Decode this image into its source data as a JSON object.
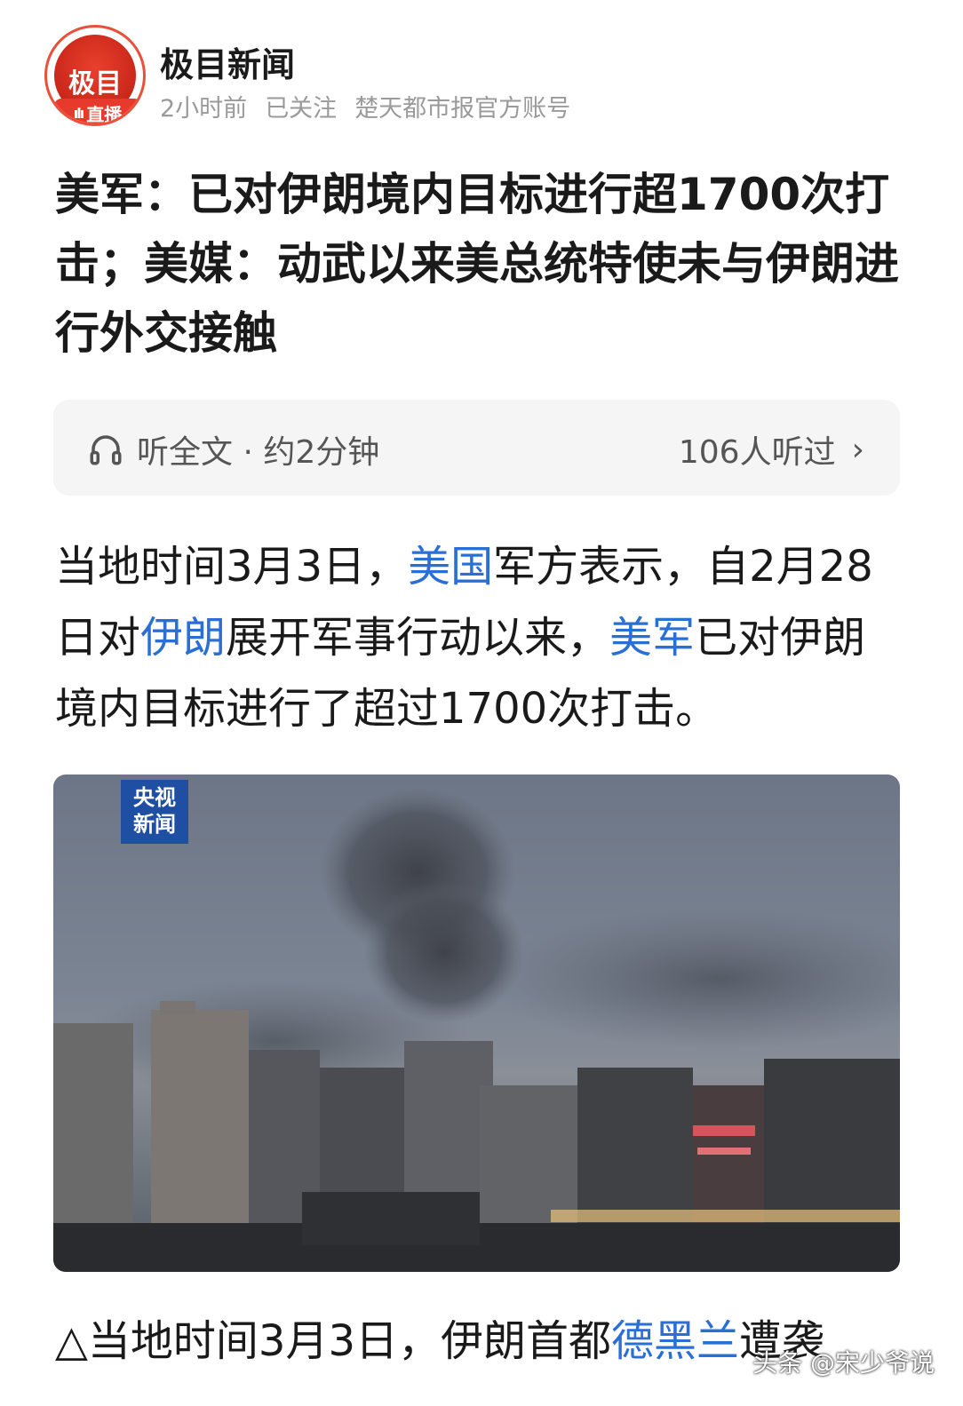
{
  "account": {
    "avatar_logo": "极目",
    "live_badge": "直播",
    "name": "极目新闻",
    "time_ago": "2小时前",
    "follow_status": "已关注",
    "description": "楚天都市报官方账号"
  },
  "article": {
    "title": "美军：已对伊朗境内目标进行超1700次打击；美媒：动武以来美总统特使未与伊朗进行外交接触",
    "listen": {
      "label": "听全文 · 约2分钟",
      "listeners": "106人听过"
    },
    "paragraph": {
      "t1": "当地时间3月3日，",
      "link1": "美国",
      "t2": "军方表示，自2月28日对",
      "link2": "伊朗",
      "t3": "展开军事行动以来，",
      "link3": "美军",
      "t4": "已对伊朗境内目标进行了超过1700次打击。"
    },
    "image": {
      "badge_line1": "央视",
      "badge_line2": "新闻"
    },
    "caption": {
      "t1": "△当地时间3月3日，伊朗首都",
      "link1": "德黑兰",
      "t2": "遭袭"
    }
  },
  "watermark": "头条 @宋少爷说",
  "colors": {
    "link": "#2a6fd6",
    "brand_red": "#e83a2c",
    "cctv_blue": "#1f4fa3"
  }
}
